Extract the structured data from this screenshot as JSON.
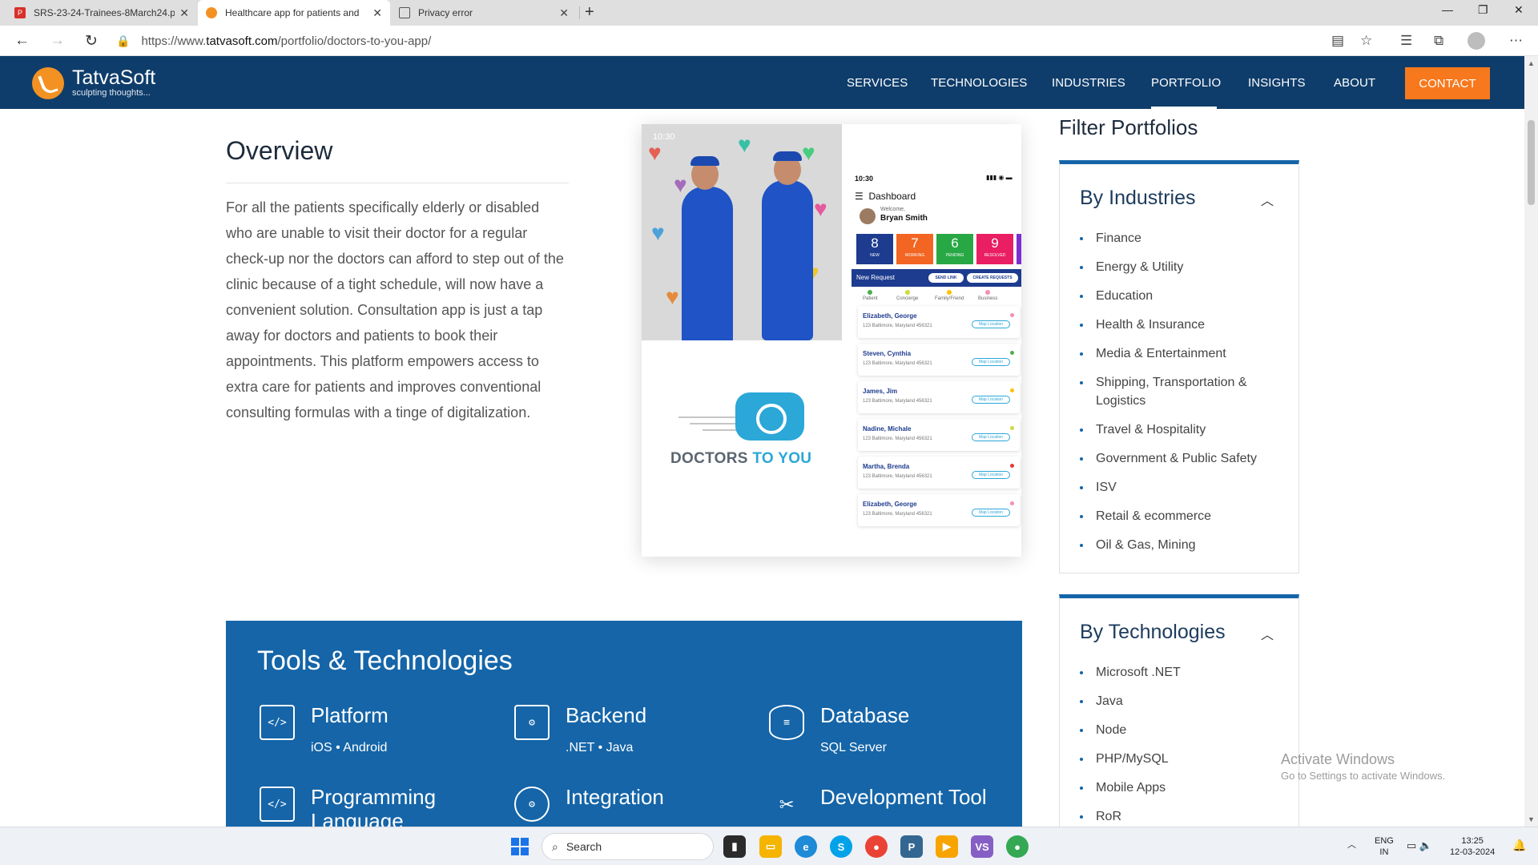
{
  "browser": {
    "tabs": [
      {
        "title": "SRS-23-24-Trainees-8March24.p",
        "icon": "pdf-icon"
      },
      {
        "title": "Healthcare app for patients and",
        "icon": "tatvasoft-favicon"
      },
      {
        "title": "Privacy error",
        "icon": "page-icon"
      }
    ],
    "url_prefix": "https://www.",
    "url_host": "tatvasoft.com",
    "url_path": "/portfolio/doctors-to-you-app/"
  },
  "site": {
    "logo_name": "TatvaSoft",
    "logo_tagline": "sculpting thoughts...",
    "menu": [
      "SERVICES",
      "TECHNOLOGIES",
      "INDUSTRIES",
      "PORTFOLIO",
      "INSIGHTS",
      "ABOUT"
    ],
    "active_menu": "PORTFOLIO",
    "contact_label": "CONTACT",
    "brand_color": "#0f3d6b",
    "accent_color": "#f7781d"
  },
  "overview": {
    "title": "Overview",
    "body": "For all the patients specifically elderly or disabled who are unable to visit their doctor for a regular check-up nor the doctors can afford to step out of the clinic because of a tight schedule, will now have a convenient solution. Consultation app is just a tap away for doctors and patients to book their appointments. This platform empowers access to extra care for patients and improves conventional consulting formulas with a tinge of digitalization."
  },
  "hero": {
    "photo_time": "10:30",
    "brand_left": "DOCTORS ",
    "brand_right": "TO YOU",
    "phone": {
      "time": "10:30",
      "title": "Dashboard",
      "welcome": "Welcome,",
      "user": "Bryan Smith",
      "stats": [
        {
          "num": "8",
          "label": "NEW",
          "color": "#1d3b8f"
        },
        {
          "num": "7",
          "label": "WORKING",
          "color": "#f26522"
        },
        {
          "num": "6",
          "label": "PENDING",
          "color": "#27a844"
        },
        {
          "num": "9",
          "label": "RESOLVED",
          "color": "#e91e63"
        }
      ],
      "new_request": "New Request",
      "send_link": "SEND LINK",
      "create_requests": "CREATE REQUESTS",
      "categories": [
        {
          "label": "Patient",
          "color": "#4caf50"
        },
        {
          "label": "Concierge",
          "color": "#cddc39"
        },
        {
          "label": "Family/Friend",
          "color": "#ffc107"
        },
        {
          "label": "Business",
          "color": "#f48fb1"
        }
      ],
      "cards": [
        {
          "name": "Elizabeth, George",
          "addr": "123 Baltimore, Maryland 456321",
          "map": "Map Location",
          "dot": "#f48fb1"
        },
        {
          "name": "Steven, Cynthia",
          "addr": "123 Baltimore, Maryland 456321",
          "map": "Map Location",
          "dot": "#4caf50"
        },
        {
          "name": "James, Jim",
          "addr": "123 Baltimore, Maryland 456321",
          "map": "Map Location",
          "dot": "#ffc107"
        },
        {
          "name": "Nadine, Michale",
          "addr": "123 Baltimore, Maryland 456321",
          "map": "Map Location",
          "dot": "#cddc39"
        },
        {
          "name": "Martha, Brenda",
          "addr": "123 Baltimore, Maryland 456321",
          "map": "Map Location",
          "dot": "#e53935"
        },
        {
          "name": "Elizabeth, George",
          "addr": "123 Baltimore, Maryland 456321",
          "map": "Map Location",
          "dot": "#f48fb1"
        }
      ]
    }
  },
  "tools": {
    "title": "Tools & Technologies",
    "items": [
      {
        "title": "Platform",
        "sub": "iOS • Android",
        "icon": "code-device-icon"
      },
      {
        "title": "Backend",
        "sub": ".NET • Java",
        "icon": "server-gear-icon"
      },
      {
        "title": "Database",
        "sub": "SQL Server",
        "icon": "database-icon"
      },
      {
        "title": "Programming Language",
        "sub": "",
        "icon": "code-window-icon"
      },
      {
        "title": "Integration",
        "sub": "",
        "icon": "gear-icon"
      },
      {
        "title": "Development Tool",
        "sub": "",
        "icon": "tools-icon"
      }
    ]
  },
  "sidebar": {
    "title": "Filter Portfolios",
    "industries": {
      "heading": "By Industries",
      "items": [
        "Finance",
        "Energy & Utility",
        "Education",
        "Health & Insurance",
        "Media & Entertainment",
        "Shipping, Transportation & Logistics",
        "Travel & Hospitality",
        "Government & Public Safety",
        "ISV",
        "Retail & ecommerce",
        "Oil & Gas, Mining"
      ]
    },
    "technologies": {
      "heading": "By Technologies",
      "items": [
        "Microsoft .NET",
        "Java",
        "Node",
        "PHP/MySQL",
        "Mobile Apps",
        "RoR"
      ]
    }
  },
  "watermark": {
    "title": "Activate Windows",
    "sub": "Go to Settings to activate Windows."
  },
  "taskbar": {
    "search_placeholder": "Search",
    "lang_top": "ENG",
    "lang_bottom": "IN",
    "time": "13:25",
    "date": "12-03-2024"
  }
}
